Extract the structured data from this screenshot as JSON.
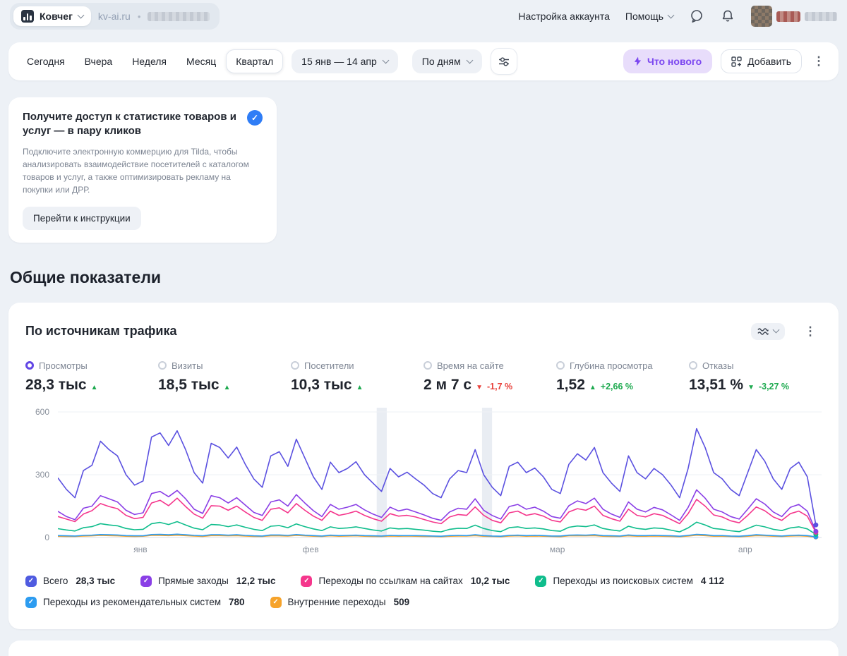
{
  "topnav": {
    "counter_name": "Ковчег",
    "site_link": "kv-ai.ru",
    "separator": "•",
    "account_settings": "Настройка аккаунта",
    "help": "Помощь"
  },
  "filter_bar": {
    "periods": [
      "Сегодня",
      "Вчера",
      "Неделя",
      "Месяц",
      "Квартал"
    ],
    "selected_period": "Квартал",
    "date_range": "15 янв — 14 апр",
    "granularity": "По дням",
    "whats_new_label": "Что нового",
    "add_label": "Добавить"
  },
  "promo_card": {
    "title": "Получите доступ к статистике товаров и услуг — в пару кликов",
    "body": "Подключите электронную коммерцию для Tilda, чтобы анализировать взаимодействие посетителей с каталогом товаров и услуг, а также оптимизировать рекламу на покупки или ДРР.",
    "cta": "Перейти к инструкции"
  },
  "section_title": "Общие показатели",
  "chart_card": {
    "title": "По источникам трафика",
    "metrics": [
      {
        "label": "Просмотры",
        "value": "28,3 тыс",
        "arrow": "▲",
        "arrow_color": "#1ca94e",
        "delta": "",
        "delta_color": "#1ca94e",
        "selected": true
      },
      {
        "label": "Визиты",
        "value": "18,5 тыс",
        "arrow": "▲",
        "arrow_color": "#1ca94e",
        "delta": "",
        "delta_color": "#1ca94e",
        "selected": false
      },
      {
        "label": "Посетители",
        "value": "10,3 тыс",
        "arrow": "▲",
        "arrow_color": "#1ca94e",
        "delta": "",
        "delta_color": "#1ca94e",
        "selected": false
      },
      {
        "label": "Время на сайте",
        "value": "2 м 7 с",
        "arrow": "▼",
        "arrow_color": "#e8403a",
        "delta": "-1,7 %",
        "delta_color": "#e8403a",
        "selected": false
      },
      {
        "label": "Глубина просмотра",
        "value": "1,52",
        "arrow": "▲",
        "arrow_color": "#1ca94e",
        "delta": "+2,66 %",
        "delta_color": "#1ca94e",
        "selected": false
      },
      {
        "label": "Отказы",
        "value": "13,51 %",
        "arrow": "▼",
        "arrow_color": "#1ca94e",
        "delta": "-3,27 %",
        "delta_color": "#1ca94e",
        "selected": false
      }
    ],
    "legend_rows": [
      [
        {
          "label": "Всего",
          "value": "28,3 тыс",
          "color": "#4f5be0"
        },
        {
          "label": "Прямые заходы",
          "value": "12,2 тыс",
          "color": "#8a3fe6"
        },
        {
          "label": "Переходы по ссылкам на сайтах",
          "value": "10,2 тыс",
          "color": "#f5368c"
        },
        {
          "label": "Переходы из поисковых систем",
          "value": "4 112",
          "color": "#0fbd8c"
        }
      ],
      [
        {
          "label": "Переходы из рекомендательных систем",
          "value": "780",
          "color": "#2d9cf0"
        },
        {
          "label": "Внутренние переходы",
          "value": "509",
          "color": "#f6a32b"
        }
      ]
    ]
  },
  "chart_data": {
    "type": "line",
    "title": "По источникам трафика",
    "x_range": "15 янв — 14 апр",
    "granularity": "По дням",
    "y_max": 600,
    "y_ticks": [
      0,
      300,
      600
    ],
    "x_ticks": [
      {
        "label": "янв",
        "pos": 0.108
      },
      {
        "label": "фев",
        "pos": 0.331
      },
      {
        "label": "мар",
        "pos": 0.654
      },
      {
        "label": "апр",
        "pos": 0.9
      }
    ],
    "highlight_bands": [
      0.424,
      0.562
    ],
    "series": [
      {
        "name": "Всего",
        "color": "#5b51e0",
        "total": "28,3 тыс",
        "values": [
          285,
          230,
          190,
          320,
          345,
          460,
          420,
          390,
          300,
          250,
          270,
          480,
          500,
          440,
          510,
          420,
          310,
          260,
          450,
          430,
          380,
          432,
          350,
          280,
          240,
          390,
          410,
          340,
          470,
          380,
          290,
          230,
          360,
          310,
          330,
          362,
          300,
          260,
          220,
          330,
          290,
          312,
          280,
          250,
          210,
          190,
          280,
          320,
          310,
          420,
          300,
          240,
          200,
          340,
          360,
          310,
          332,
          290,
          230,
          210,
          350,
          400,
          370,
          430,
          310,
          260,
          220,
          390,
          310,
          280,
          330,
          300,
          250,
          190,
          330,
          520,
          430,
          310,
          280,
          230,
          200,
          310,
          420,
          365,
          280,
          230,
          330,
          360,
          290,
          60
        ]
      },
      {
        "name": "Прямые заходы",
        "color": "#8a3fe6",
        "total": "12,2 тыс",
        "values": [
          125,
          100,
          85,
          140,
          150,
          200,
          185,
          170,
          130,
          110,
          118,
          210,
          220,
          195,
          225,
          185,
          135,
          115,
          200,
          190,
          165,
          190,
          155,
          120,
          105,
          170,
          180,
          150,
          205,
          165,
          128,
          100,
          158,
          135,
          145,
          158,
          132,
          112,
          96,
          145,
          127,
          136,
          122,
          108,
          92,
          82,
          122,
          140,
          135,
          185,
          130,
          105,
          88,
          148,
          158,
          135,
          145,
          126,
          100,
          92,
          152,
          175,
          162,
          188,
          135,
          112,
          96,
          170,
          135,
          122,
          144,
          132,
          108,
          82,
          144,
          228,
          188,
          135,
          122,
          100,
          88,
          135,
          185,
          160,
          122,
          100,
          144,
          158,
          126,
          30
        ]
      },
      {
        "name": "Переходы по ссылкам на сайтах",
        "color": "#f5368c",
        "total": "10,2 тыс",
        "values": [
          100,
          88,
          76,
          112,
          128,
          162,
          148,
          138,
          106,
          90,
          96,
          165,
          178,
          152,
          188,
          148,
          112,
          92,
          152,
          150,
          130,
          150,
          122,
          96,
          82,
          135,
          142,
          118,
          162,
          130,
          102,
          82,
          126,
          106,
          114,
          126,
          106,
          90,
          78,
          114,
          102,
          106,
          98,
          86,
          74,
          66,
          98,
          110,
          106,
          146,
          106,
          82,
          70,
          118,
          126,
          106,
          114,
          102,
          82,
          74,
          122,
          138,
          130,
          150,
          106,
          90,
          78,
          135,
          106,
          98,
          114,
          106,
          86,
          66,
          114,
          182,
          150,
          108,
          98,
          80,
          70,
          106,
          146,
          128,
          98,
          82,
          114,
          126,
          102,
          25
        ]
      },
      {
        "name": "Переходы из поисковых систем",
        "color": "#0fbd8c",
        "total": "4 112",
        "values": [
          42,
          36,
          31,
          47,
          52,
          66,
          60,
          56,
          43,
          37,
          39,
          66,
          72,
          62,
          76,
          60,
          45,
          37,
          62,
          60,
          52,
          60,
          49,
          39,
          33,
          54,
          57,
          47,
          65,
          52,
          41,
          33,
          51,
          43,
          46,
          51,
          43,
          36,
          31,
          46,
          41,
          43,
          39,
          35,
          30,
          27,
          39,
          44,
          43,
          59,
          43,
          33,
          28,
          47,
          51,
          43,
          46,
          41,
          33,
          30,
          49,
          55,
          52,
          60,
          43,
          36,
          31,
          54,
          43,
          39,
          46,
          43,
          35,
          27,
          46,
          73,
          60,
          43,
          39,
          32,
          28,
          43,
          59,
          51,
          39,
          33,
          46,
          51,
          41,
          15
        ]
      },
      {
        "name": "Переходы из рекомендательных систем",
        "color": "#2d9cf0",
        "total": "780",
        "values": [
          9,
          8,
          7,
          10,
          11,
          14,
          13,
          12,
          9,
          8,
          8,
          14,
          15,
          13,
          16,
          13,
          10,
          8,
          13,
          13,
          11,
          13,
          10,
          8,
          7,
          12,
          12,
          10,
          14,
          11,
          9,
          7,
          11,
          9,
          10,
          11,
          9,
          8,
          7,
          10,
          9,
          9,
          9,
          8,
          7,
          6,
          9,
          10,
          9,
          13,
          9,
          7,
          6,
          10,
          11,
          9,
          10,
          9,
          7,
          7,
          11,
          12,
          11,
          13,
          9,
          8,
          7,
          12,
          9,
          9,
          10,
          9,
          8,
          6,
          10,
          15,
          13,
          9,
          9,
          7,
          6,
          9,
          13,
          11,
          9,
          7,
          10,
          11,
          9,
          3
        ]
      },
      {
        "name": "Внутренние переходы",
        "color": "#f6a32b",
        "total": "509",
        "values": [
          6,
          5,
          5,
          7,
          8,
          10,
          9,
          8,
          6,
          5,
          6,
          10,
          10,
          9,
          11,
          9,
          7,
          5,
          9,
          9,
          8,
          9,
          7,
          5,
          5,
          8,
          8,
          7,
          10,
          8,
          6,
          5,
          8,
          6,
          7,
          8,
          6,
          5,
          5,
          7,
          6,
          7,
          6,
          5,
          5,
          4,
          6,
          7,
          7,
          9,
          6,
          5,
          4,
          7,
          8,
          6,
          7,
          6,
          5,
          4,
          8,
          8,
          8,
          9,
          6,
          5,
          5,
          8,
          6,
          6,
          7,
          6,
          5,
          4,
          7,
          11,
          9,
          6,
          6,
          5,
          4,
          6,
          9,
          8,
          6,
          5,
          7,
          8,
          6,
          2
        ]
      }
    ]
  }
}
